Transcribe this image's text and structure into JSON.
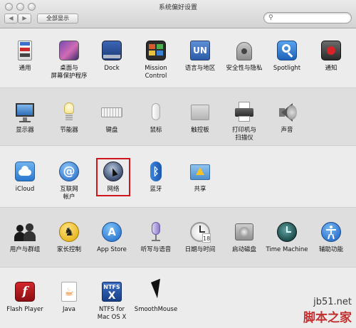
{
  "window": {
    "title": "系统偏好设置",
    "show_all_label": "全部显示",
    "back_label": "◀",
    "forward_label": "▶",
    "search_placeholder": ""
  },
  "rows": [
    {
      "items": [
        {
          "label": "通用",
          "icon": "general-icon"
        },
        {
          "label": "桌面与\n屏幕保护程序",
          "icon": "desktop-screensaver-icon"
        },
        {
          "label": "Dock",
          "icon": "dock-icon"
        },
        {
          "label": "Mission\nControl",
          "icon": "mission-control-icon"
        },
        {
          "label": "语言与地区",
          "icon": "language-region-icon"
        },
        {
          "label": "安全性与隐私",
          "icon": "security-privacy-icon"
        },
        {
          "label": "Spotlight",
          "icon": "spotlight-icon"
        },
        {
          "label": "通知",
          "icon": "notifications-icon"
        }
      ]
    },
    {
      "items": [
        {
          "label": "显示器",
          "icon": "displays-icon"
        },
        {
          "label": "节能器",
          "icon": "energy-saver-icon"
        },
        {
          "label": "键盘",
          "icon": "keyboard-icon"
        },
        {
          "label": "鼠标",
          "icon": "mouse-icon"
        },
        {
          "label": "触控板",
          "icon": "trackpad-icon"
        },
        {
          "label": "打印机与\n扫描仪",
          "icon": "printers-scanners-icon"
        },
        {
          "label": "声音",
          "icon": "sound-icon"
        }
      ]
    },
    {
      "items": [
        {
          "label": "iCloud",
          "icon": "icloud-icon"
        },
        {
          "label": "互联网\n帐户",
          "icon": "internet-accounts-icon"
        },
        {
          "label": "网络",
          "icon": "network-icon"
        },
        {
          "label": "蓝牙",
          "icon": "bluetooth-icon"
        },
        {
          "label": "共享",
          "icon": "sharing-icon"
        }
      ]
    },
    {
      "items": [
        {
          "label": "用户与群组",
          "icon": "users-groups-icon"
        },
        {
          "label": "家长控制",
          "icon": "parental-controls-icon"
        },
        {
          "label": "App Store",
          "icon": "app-store-icon"
        },
        {
          "label": "听写与语音",
          "icon": "dictation-speech-icon"
        },
        {
          "label": "日期与时间",
          "icon": "date-time-icon"
        },
        {
          "label": "启动磁盘",
          "icon": "startup-disk-icon"
        },
        {
          "label": "Time Machine",
          "icon": "time-machine-icon"
        },
        {
          "label": "辅助功能",
          "icon": "accessibility-icon"
        }
      ]
    },
    {
      "items": [
        {
          "label": "Flash Player",
          "icon": "flash-player-icon"
        },
        {
          "label": "Java",
          "icon": "java-icon"
        },
        {
          "label": "NTFS for\nMac OS X",
          "icon": "ntfs-icon"
        },
        {
          "label": "SmoothMouse",
          "icon": "smoothmouse-icon"
        }
      ]
    }
  ],
  "icon_badges": {
    "general": "File\nNew\nOne",
    "ntfs": "NTFS",
    "date": "18"
  },
  "watermark": {
    "url": "jb51.net",
    "name": "脚本之家"
  },
  "colors": {
    "highlight_border": "#d0161c",
    "spotlight_blue": "#2f7ed8",
    "notification_red": "#d8232a"
  }
}
